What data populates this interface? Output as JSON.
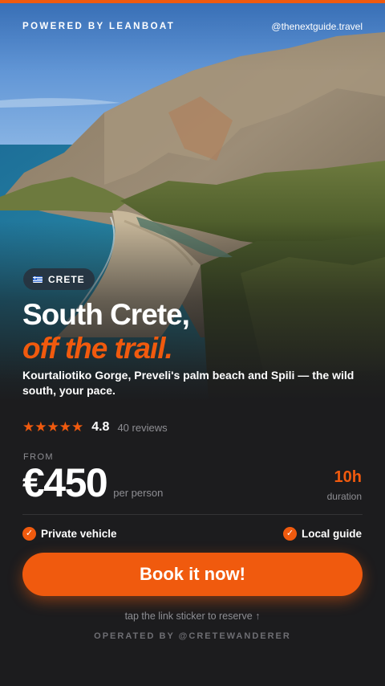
{
  "header": {
    "brand": "POWERED BY LEANBOAT",
    "handle": "@thenextguide.travel"
  },
  "hero": {
    "location_chip": "CRETE",
    "location_flag_icon": "greece-flag-icon",
    "title_line1": "South Crete,",
    "title_line2": "off the trail.",
    "subtitle": "Kourtaliotiko Gorge, Preveli's palm beach and Spili — the wild south, your pace."
  },
  "rating": {
    "stars": "★★★★★",
    "value": "4.8",
    "reviews": "40 reviews"
  },
  "pricing": {
    "from_label": "FROM",
    "price": "€450",
    "per_label": "per person",
    "duration_value": "10h",
    "duration_label": "duration"
  },
  "features": [
    {
      "label": "Private vehicle",
      "icon": "check-icon"
    },
    {
      "label": "Local guide",
      "icon": "check-icon"
    }
  ],
  "cta": {
    "label": "Book it now!",
    "hint": "tap the link sticker to reserve ↑"
  },
  "footer": {
    "operated_by": "OPERATED BY @CRETEWANDERER"
  },
  "colors": {
    "accent": "#f05a0e",
    "background": "#1c1c1e",
    "muted_text": "#8e8e93"
  }
}
